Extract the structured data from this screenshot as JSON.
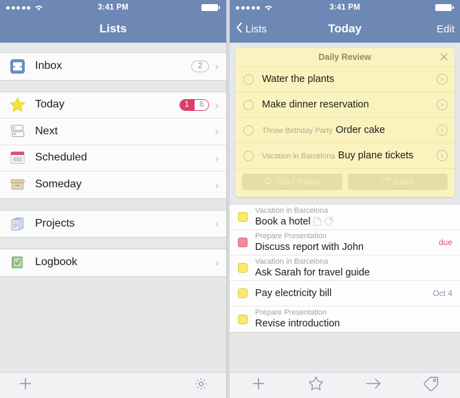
{
  "status": {
    "time": "3:41 PM",
    "signal_dots": 5,
    "wifi_icon": "wifi-icon",
    "battery_icon": "battery-icon"
  },
  "colors": {
    "navbar_blue": "#6d88b4",
    "card_yellow": "#faf3bd",
    "badge_pink": "#dd3c67",
    "due_red": "#e34b6e",
    "date_blue": "#7f94b8",
    "checkbox_yellow": "#fbe96a",
    "checkbox_pink": "#f5879f"
  },
  "left_screen": {
    "nav": {
      "title": "Lists"
    },
    "groups": [
      {
        "rows": [
          {
            "icon": "inbox-icon",
            "label": "Inbox",
            "badge_type": "plain",
            "badge": "2"
          }
        ]
      },
      {
        "rows": [
          {
            "icon": "star-icon",
            "label": "Today",
            "badge_type": "split",
            "badge_left": "1",
            "badge_right": "8"
          },
          {
            "icon": "next-list-icon",
            "label": "Next",
            "badge_type": "none"
          },
          {
            "icon": "calendar-icon",
            "label": "Scheduled",
            "badge_type": "none"
          },
          {
            "icon": "box-icon",
            "label": "Someday",
            "badge_type": "none"
          }
        ]
      },
      {
        "rows": [
          {
            "icon": "documents-icon",
            "label": "Projects",
            "badge_type": "none"
          }
        ]
      },
      {
        "rows": [
          {
            "icon": "logbook-icon",
            "label": "Logbook",
            "badge_type": "none"
          }
        ]
      }
    ],
    "toolbar": [
      {
        "icon": "plus-icon",
        "label": "New To-Do"
      },
      {
        "icon": "gear-icon",
        "label": "Settings"
      }
    ]
  },
  "right_screen": {
    "nav": {
      "back_label": "Lists",
      "back_icon": "chevron-left-icon",
      "title": "Today",
      "edit_label": "Edit"
    },
    "card": {
      "title": "Daily Review",
      "close_icon": "close-icon",
      "items": [
        {
          "checkbox_icon": "circle-checkbox-icon",
          "project": "",
          "title": "Water the plants",
          "disclosure_icon": "chevron-right-circle-icon"
        },
        {
          "checkbox_icon": "circle-checkbox-icon",
          "project": "",
          "title": "Make dinner reservation",
          "disclosure_icon": "chevron-right-circle-icon"
        },
        {
          "checkbox_icon": "circle-checkbox-icon",
          "project": "Throw Birthday Party",
          "title": "Order cake",
          "disclosure_icon": "chevron-right-circle-icon"
        },
        {
          "checkbox_icon": "circle-checkbox-icon",
          "project": "Vacation in Barcelona",
          "title": "Buy plane tickets",
          "disclosure_icon": "chevron-right-circle-icon"
        }
      ],
      "actions": [
        {
          "icon": "star-icon",
          "label": "Start Today"
        },
        {
          "icon": "arrow-right-icon",
          "label": "Later"
        }
      ]
    },
    "tasks": [
      {
        "checkbox_color": "yellow",
        "project": "Vacation in Barcelona",
        "title": "Book a hotel",
        "icons": [
          "note-icon",
          "tag-icon"
        ],
        "meta": "",
        "meta_type": "none"
      },
      {
        "checkbox_color": "pink",
        "project": "Prepare Presentation",
        "title": "Discuss report with John",
        "icons": [],
        "meta": "due",
        "meta_type": "due"
      },
      {
        "checkbox_color": "yellow",
        "project": "Vacation in Barcelona",
        "title": "Ask Sarah for travel guide",
        "icons": [],
        "meta": "",
        "meta_type": "none"
      },
      {
        "checkbox_color": "yellow",
        "project": "",
        "title": "Pay electricity bill",
        "icons": [],
        "meta": "Oct 4",
        "meta_type": "date"
      },
      {
        "checkbox_color": "yellow",
        "project": "Prepare Presentation",
        "title": "Revise introduction",
        "icons": [],
        "meta": "",
        "meta_type": "none"
      }
    ],
    "toolbar": [
      {
        "icon": "plus-icon",
        "label": "New To-Do"
      },
      {
        "icon": "star-icon",
        "label": "Today"
      },
      {
        "icon": "arrow-right-icon",
        "label": "Move"
      },
      {
        "icon": "tag-icon",
        "label": "Tags"
      }
    ]
  }
}
